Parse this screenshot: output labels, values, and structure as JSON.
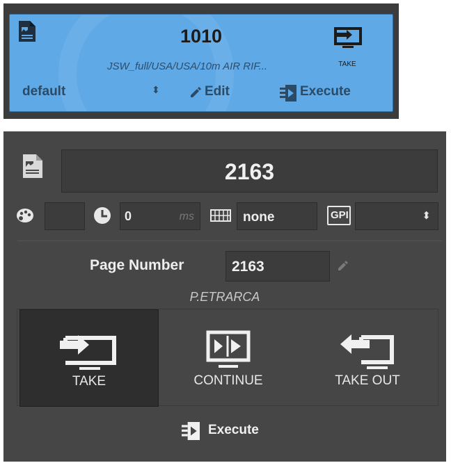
{
  "top_card": {
    "title": "1010",
    "path": "JSW_full/USA/USA/10m AIR RIF...",
    "take_label": "TAKE",
    "select_value": "default",
    "select_arrows": "⬍",
    "edit_label": "Edit",
    "execute_label": "Execute"
  },
  "panel": {
    "title": "2163",
    "duration_value": "0",
    "duration_unit": "ms",
    "layer_value": "none",
    "gpi_label": "GPI",
    "gpi_arrows": "⬍",
    "page_number_label": "Page Number",
    "page_number_value": "2163",
    "author": "P.ETRARCA",
    "buttons": {
      "take": "TAKE",
      "continue": "CONTINUE",
      "take_out": "TAKE OUT"
    },
    "execute_label": "Execute"
  },
  "colors": {
    "card_blue": "#5fa9e6",
    "panel_gray": "#464646",
    "active_button": "#2e2e2e"
  }
}
